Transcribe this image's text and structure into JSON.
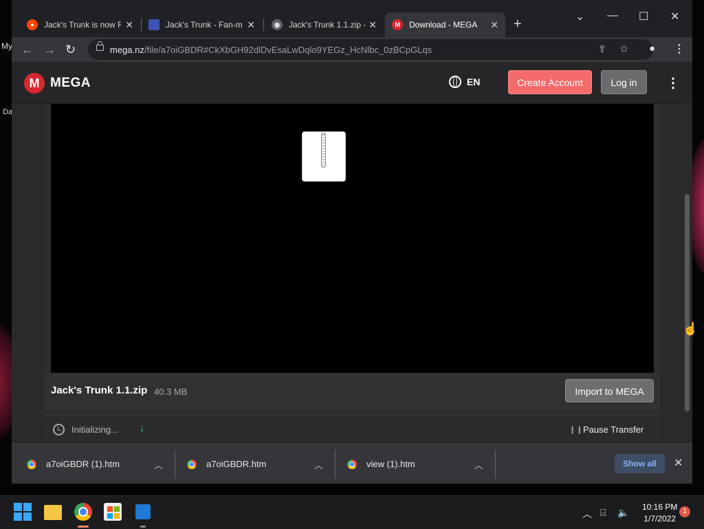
{
  "desktop": {
    "labels": [
      "My",
      "Da"
    ]
  },
  "browser": {
    "tabs": [
      {
        "title": "Jack's Trunk is now Re",
        "icon": "reddit-icon",
        "color": "#ff4500"
      },
      {
        "title": "Jack's Trunk - Fan-ma",
        "icon": "fandom-icon",
        "color": "#3f51b5"
      },
      {
        "title": "Jack's Trunk 1.1.zip -",
        "icon": "globe-icon",
        "color": "#9aa0a6"
      },
      {
        "title": "Download - MEGA",
        "icon": "mega-icon",
        "color": "#d9272e"
      }
    ],
    "url_host": "mega.nz",
    "url_path": "/file/a7oiGBDR#CkXbGH92dlDvEsaLwDqlo9YEGz_HcNlbc_0zBCpGLqs"
  },
  "mega": {
    "logo_letter": "M",
    "brand": "MEGA",
    "lang": "EN",
    "create_account": "Create Account",
    "login": "Log in",
    "file_name": "Jack's Trunk 1.1.zip",
    "file_size": "40.3 MB",
    "import_label": "Import to MEGA",
    "status": "Initializing...",
    "pause_label": "Pause Transfer"
  },
  "downloads": {
    "items": [
      {
        "name": "a7oiGBDR (1).htm"
      },
      {
        "name": "a7oiGBDR.htm"
      },
      {
        "name": "view (1).htm"
      }
    ],
    "show_all": "Show all"
  },
  "taskbar": {
    "time": "10:16 PM",
    "date": "1/7/2022",
    "notification_count": "1"
  }
}
